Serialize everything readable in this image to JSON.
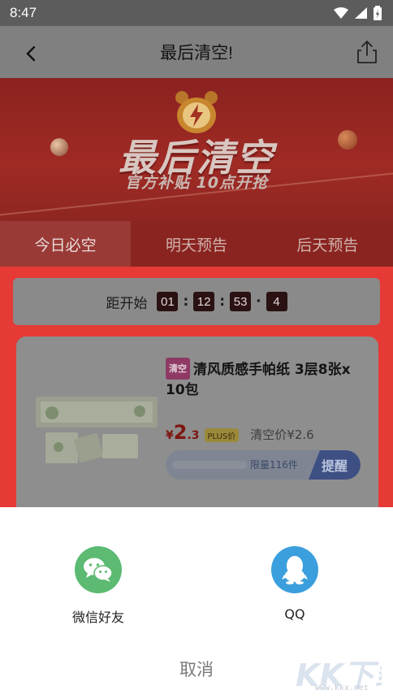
{
  "status_bar": {
    "time": "8:47"
  },
  "nav": {
    "title": "最后清空!"
  },
  "banner": {
    "title": "最后清空",
    "subtitle": "官方补贴  10点开抢"
  },
  "tabs": [
    {
      "label": "今日必空",
      "active": true
    },
    {
      "label": "明天预告",
      "active": false
    },
    {
      "label": "后天预告",
      "active": false
    }
  ],
  "countdown": {
    "label": "距开始",
    "hours": "01",
    "minutes": "12",
    "seconds": "53",
    "tenths": "4"
  },
  "product": {
    "tag": "清空",
    "title": "清风质感手帕纸 3层8张x 10包",
    "price_symbol": "¥",
    "price_int": "2",
    "price_dec": ".3",
    "plus_label": "PLUS价",
    "clear_price": "清空价¥2.6",
    "limit_text": "限量116件",
    "remind_label": "提醒"
  },
  "share_sheet": {
    "options": [
      {
        "label": "微信好友",
        "icon": "wechat-icon"
      },
      {
        "label": "QQ",
        "icon": "qq-icon"
      }
    ],
    "cancel_label": "取消"
  },
  "watermark": {
    "text": "KK下载",
    "url": "www.kkx.net"
  },
  "colors": {
    "wechat": "#5cba72",
    "qq": "#3c9fdd",
    "banner_red": "#e53a35"
  }
}
